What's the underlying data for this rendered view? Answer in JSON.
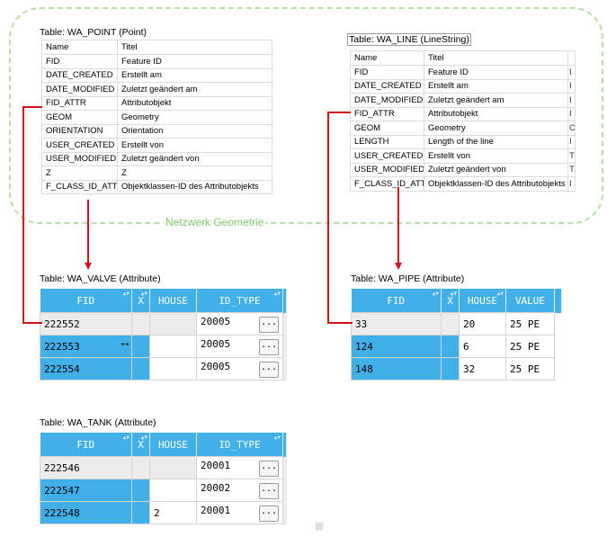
{
  "group": {
    "label": "Netzwerk Geometrie",
    "color": "#7ccb62"
  },
  "wa_point": {
    "caption": "Table: WA_POINT (Point)",
    "headers": [
      "Name",
      "Titel"
    ],
    "rows": [
      [
        "FID",
        "Feature ID"
      ],
      [
        "DATE_CREATED",
        "Erstellt am"
      ],
      [
        "DATE_MODIFIED",
        "Zuletzt geändert am"
      ],
      [
        "FID_ATTR",
        "Attributobjekt"
      ],
      [
        "GEOM",
        "Geometry"
      ],
      [
        "ORIENTATION",
        "Orientation"
      ],
      [
        "USER_CREATED",
        "Erstellt von"
      ],
      [
        "USER_MODIFIED",
        "Zuletzt geändert von"
      ],
      [
        "Z",
        "Z"
      ],
      [
        "F_CLASS_ID_ATTR",
        "Objektklassen-ID des Attributobjekts"
      ]
    ]
  },
  "wa_line": {
    "caption": "Table: WA_LINE (LineString)",
    "headers": [
      "Name",
      "Titel",
      ""
    ],
    "rows": [
      [
        "FID",
        "Feature ID",
        "I"
      ],
      [
        "DATE_CREATED",
        "Erstellt am",
        "I"
      ],
      [
        "DATE_MODIFIED",
        "Zuletzt geändert am",
        "I"
      ],
      [
        "FID_ATTR",
        "Attributobjekt",
        "I"
      ],
      [
        "GEOM",
        "Geometry",
        "C"
      ],
      [
        "LENGTH",
        "Length of the line",
        "I"
      ],
      [
        "USER_CREATED",
        "Erstellt von",
        "T"
      ],
      [
        "USER_MODIFIED",
        "Zuletzt geändert von",
        "T"
      ],
      [
        "F_CLASS_ID_ATTR",
        "Objektklassen-ID des Attributobjekts",
        "I"
      ]
    ]
  },
  "wa_valve": {
    "caption": "Table: WA_VALVE (Attribute)",
    "headers": [
      "FID",
      "X",
      "HOUSE",
      "ID_TYPE"
    ],
    "button": "...",
    "rows": [
      {
        "fid": "222552",
        "x": "",
        "house": "",
        "id_type": "20005"
      },
      {
        "fid": "222553",
        "x": "",
        "house": "",
        "id_type": "20005"
      },
      {
        "fid": "222554",
        "x": "",
        "house": "",
        "id_type": "20005"
      }
    ]
  },
  "wa_pipe": {
    "caption": "Table: WA_PIPE (Attribute)",
    "headers": [
      "FID",
      "X",
      "HOUSE",
      "VALUE"
    ],
    "rows": [
      {
        "fid": "33",
        "x": "",
        "house": "20",
        "value": "25 PE"
      },
      {
        "fid": "124",
        "x": "",
        "house": "6",
        "value": "25 PE"
      },
      {
        "fid": "148",
        "x": "",
        "house": "32",
        "value": "25 PE"
      }
    ]
  },
  "wa_tank": {
    "caption": "Table: WA_TANK (Attribute)",
    "headers": [
      "FID",
      "X",
      "HOUSE",
      "ID_TYPE"
    ],
    "button": "...",
    "rows": [
      {
        "fid": "222546",
        "x": "",
        "house": "",
        "id_type": "20001"
      },
      {
        "fid": "222547",
        "x": "",
        "house": "",
        "id_type": "20002"
      },
      {
        "fid": "222548",
        "x": "",
        "house": "2",
        "id_type": "20001"
      }
    ]
  },
  "colors": {
    "header_blue": "#42b0e8",
    "link_red": "#d0131b",
    "group_dash": "#b6e0a3"
  }
}
